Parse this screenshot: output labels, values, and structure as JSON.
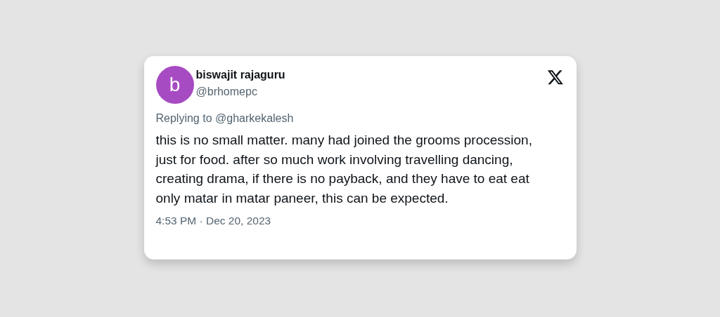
{
  "tweet": {
    "avatar": {
      "letter": "b",
      "color": "#a64bc2"
    },
    "name": "biswajit rajaguru",
    "handle": "@brhomepc",
    "replying_to": "Replying to @gharkekalesh",
    "text": "this is no small matter. many had joined the grooms procession, just for food. after so much work involving travelling dancing, creating drama, if there is no payback, and they have to eat eat only matar in matar paneer, this can be expected.",
    "timestamp": "4:53 PM · Dec 20, 2023"
  }
}
